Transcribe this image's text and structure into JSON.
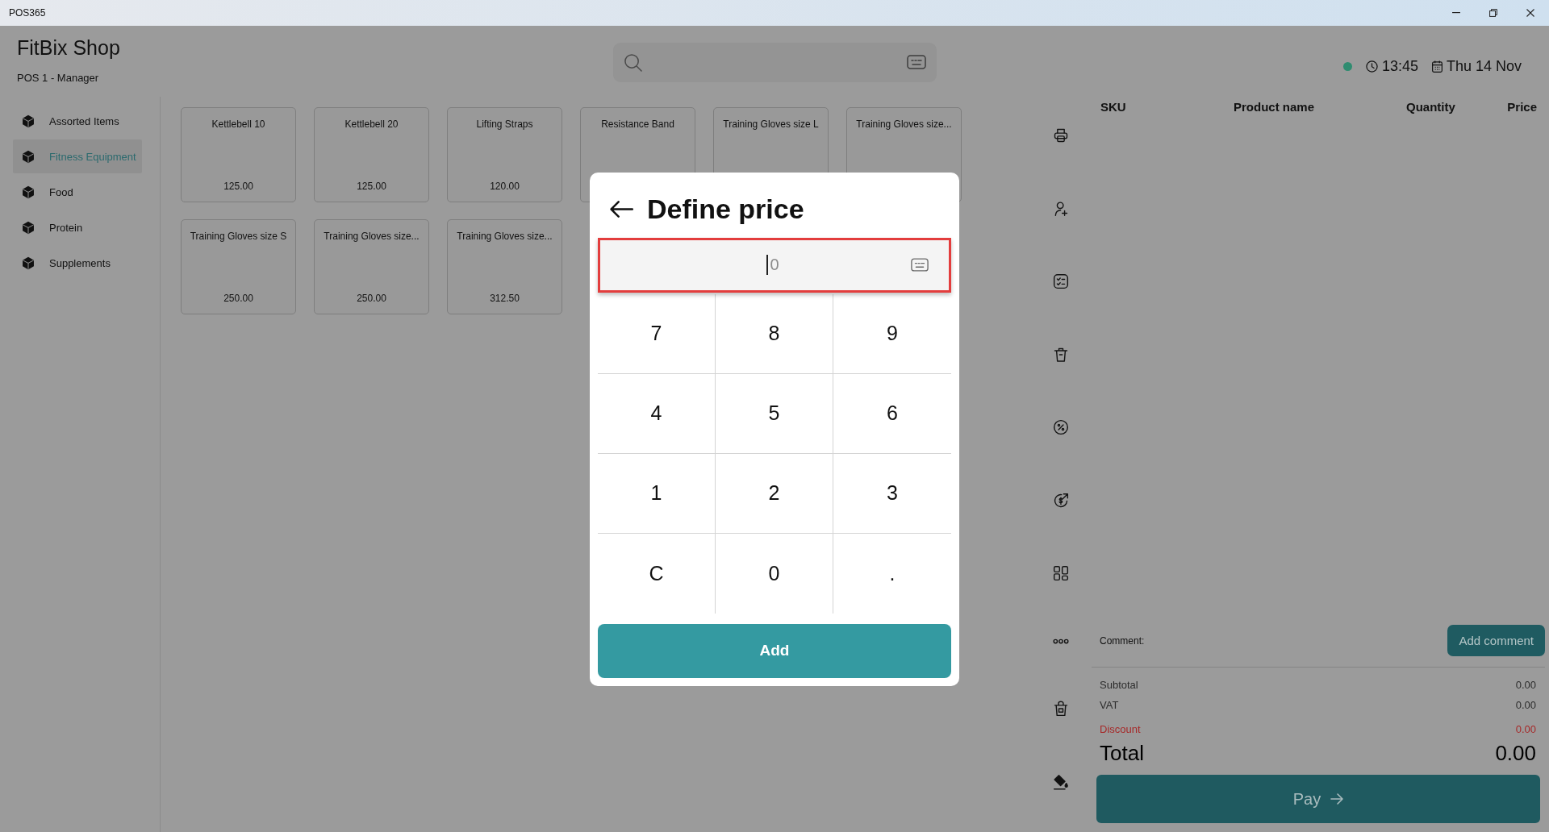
{
  "window": {
    "title": "POS365"
  },
  "header": {
    "shop_name": "FitBix Shop",
    "terminal": "POS 1 - Manager"
  },
  "status": {
    "connected": true,
    "time": "13:45",
    "date": "Thu 14 Nov"
  },
  "sidebar": {
    "items": [
      {
        "label": "Assorted Items",
        "selected": false
      },
      {
        "label": "Fitness Equipment",
        "selected": true
      },
      {
        "label": "Food",
        "selected": false
      },
      {
        "label": "Protein",
        "selected": false
      },
      {
        "label": "Supplements",
        "selected": false
      }
    ]
  },
  "products": [
    {
      "name": "Kettlebell 10",
      "price": "125.00"
    },
    {
      "name": "Kettlebell 20",
      "price": "125.00"
    },
    {
      "name": "Lifting Straps",
      "price": "120.00"
    },
    {
      "name": "Resistance Band"
    },
    {
      "name": "Training Gloves size L"
    },
    {
      "name": "Training Gloves size..."
    },
    {
      "name": "Training Gloves size S",
      "price": "250.00"
    },
    {
      "name": "Training Gloves size...",
      "price": "250.00"
    },
    {
      "name": "Training Gloves size...",
      "price": "312.50"
    }
  ],
  "order_table": {
    "columns": [
      "SKU",
      "Product name",
      "Quantity",
      "Price"
    ]
  },
  "comment": {
    "label": "Comment:",
    "button": "Add comment"
  },
  "totals": [
    {
      "kind": "line",
      "label": "Subtotal",
      "value": "0.00"
    },
    {
      "kind": "line",
      "label": "VAT",
      "value": "0.00"
    },
    {
      "kind": "discount",
      "label": "Discount",
      "value": "0.00"
    },
    {
      "kind": "total",
      "label": "Total",
      "value": "0.00"
    }
  ],
  "pay_button": {
    "label": "Pay"
  },
  "dialog": {
    "title": "Define price",
    "input": {
      "placeholder": "0",
      "focused": true
    },
    "keys": [
      "7",
      "8",
      "9",
      "4",
      "5",
      "6",
      "1",
      "2",
      "3",
      "C",
      "0",
      "."
    ],
    "confirm": "Add"
  }
}
